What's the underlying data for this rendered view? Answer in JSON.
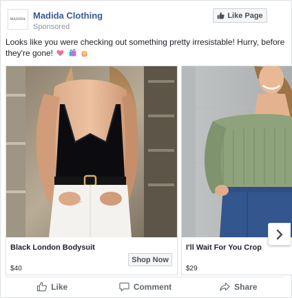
{
  "post": {
    "page_name": "Madida Clothing",
    "sponsored_label": "Sponsored",
    "logo_text": "MADIDA",
    "like_page_label": "Like Page",
    "text": "Looks like you were checking out something pretty irresistable! Hurry, before they're gone!",
    "emojis": [
      "heart-icon",
      "shopping-bags-icon",
      "woman-icon"
    ]
  },
  "carousel": {
    "cards": [
      {
        "title": "Black London Bodysuit",
        "price": "$40",
        "cta": "Shop Now"
      },
      {
        "title": "I'll Wait For You Crop",
        "price": "$29"
      }
    ],
    "next_icon": "chevron-right-icon"
  },
  "actions": {
    "like": "Like",
    "comment": "Comment",
    "share": "Share"
  },
  "colors": {
    "page_name": "#385898",
    "muted": "#90949c",
    "action_text": "#606770",
    "border": "#dddfe2"
  }
}
